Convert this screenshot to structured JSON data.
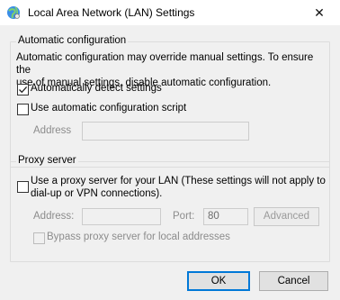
{
  "window": {
    "title": "Local Area Network (LAN) Settings",
    "close_glyph": "✕"
  },
  "auto_config": {
    "legend": "Automatic configuration",
    "description_line1": "Automatic configuration may override manual settings.  To ensure the",
    "description_line2": "use of manual settings, disable automatic configuration.",
    "detect_label": "Automatically detect settings",
    "detect_checked": true,
    "script_label": "Use automatic configuration script",
    "script_checked": false,
    "address_label": "Address",
    "address_value": ""
  },
  "proxy": {
    "legend": "Proxy server",
    "use_proxy_line1": "Use a proxy server for your LAN (These settings will not apply to",
    "use_proxy_line2": "dial-up or VPN connections).",
    "use_proxy_checked": false,
    "address_label": "Address:",
    "address_value": "",
    "port_label": "Port:",
    "port_value": "80",
    "advanced_label": "Advanced",
    "bypass_label": "Bypass proxy server for local addresses",
    "bypass_checked": false
  },
  "buttons": {
    "ok": "OK",
    "cancel": "Cancel"
  }
}
